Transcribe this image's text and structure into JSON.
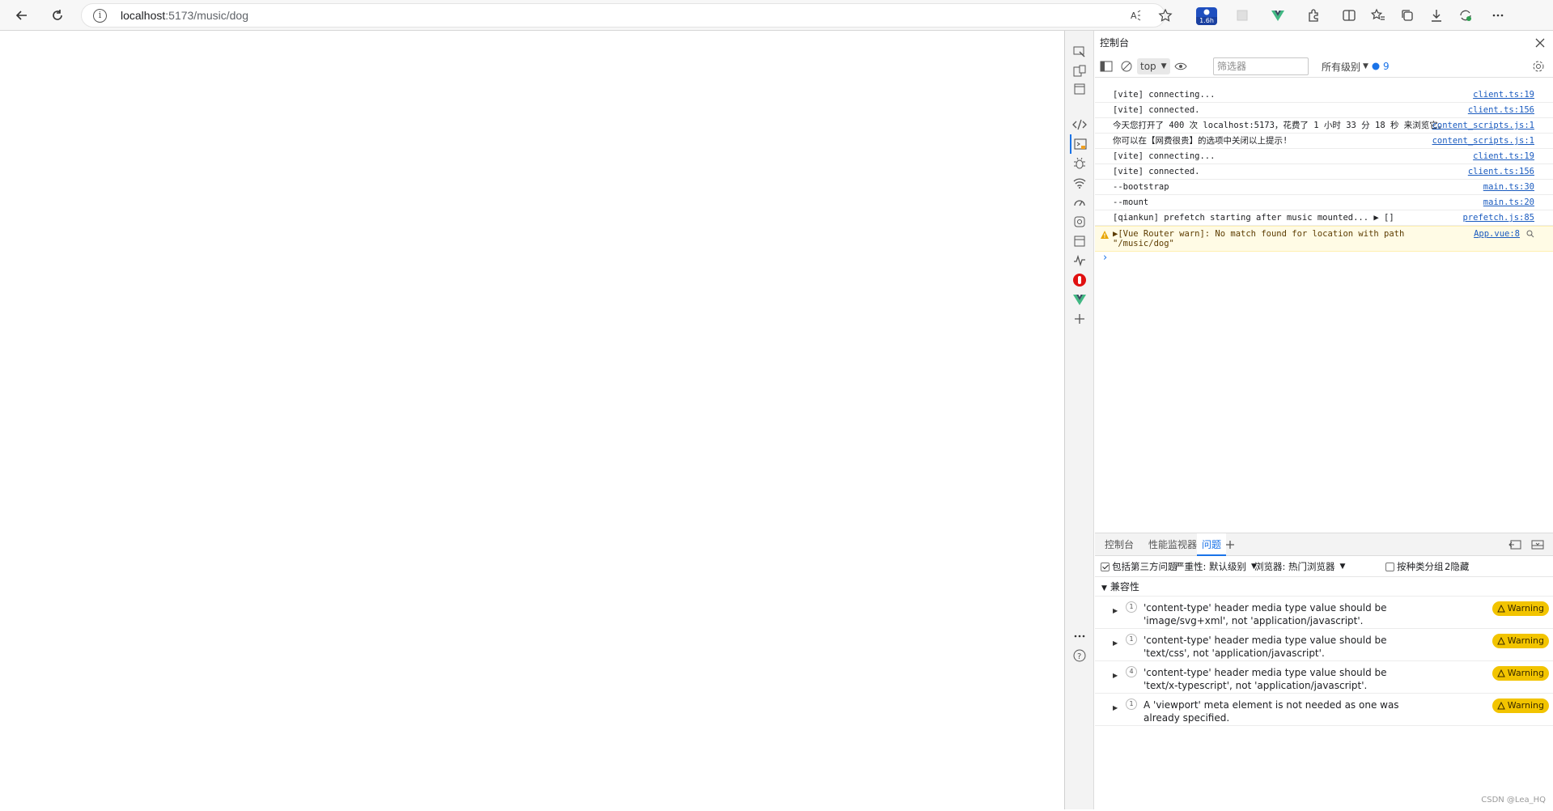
{
  "browser": {
    "url_host": "localhost",
    "url_path": ":5173/music/dog",
    "ext_badge": "1.6h"
  },
  "devtools": {
    "panel_title": "控制台",
    "console_toolbar": {
      "context": "top",
      "filter_placeholder": "筛选器",
      "levels": "所有级别",
      "message_count": "9"
    },
    "logs": [
      {
        "text": "[vite] connecting...",
        "src": "client.ts:19"
      },
      {
        "text": "[vite] connected.",
        "src": "client.ts:156"
      },
      {
        "text": "今天您打开了 400 次 localhost:5173，花费了 1 小时 33 分 18 秒 来浏览它。",
        "src": "content_scripts.js:1"
      },
      {
        "text": "你可以在【网费很贵】的选项中关闭以上提示!",
        "src": "content_scripts.js:1"
      },
      {
        "text": "[vite] connecting...",
        "src": "client.ts:19"
      },
      {
        "text": "[vite] connected.",
        "src": "client.ts:156"
      },
      {
        "text": "--bootstrap",
        "src": "main.ts:30"
      },
      {
        "text": "--mount",
        "src": "main.ts:20"
      },
      {
        "text": "[qiankun] prefetch starting after music mounted... ▶ []",
        "src": "prefetch.js:85"
      }
    ],
    "warning": {
      "text": "▶[Vue Router warn]: No match found for location with path \"/music/dog\"",
      "src": "App.vue:8"
    },
    "drawer": {
      "tabs": [
        "控制台",
        "性能监视器",
        "问题"
      ],
      "active_tab": "问题",
      "include_third_party": "包括第三方问题",
      "severity": "严重性: 默认级别",
      "browser_filter": "浏览器:  热门浏览器",
      "group_by_kind": "按种类分组",
      "hidden": "2隐藏",
      "category": "兼容性",
      "issues": [
        {
          "count": "1",
          "text": "'content-type' header media type value should be 'image/svg+xml', not 'application/javascript'.",
          "badge": "Warning"
        },
        {
          "count": "1",
          "text": "'content-type' header media type value should be 'text/css', not 'application/javascript'.",
          "badge": "Warning"
        },
        {
          "count": "4",
          "text": "'content-type' header media type value should be 'text/x-typescript', not 'application/javascript'.",
          "badge": "Warning"
        },
        {
          "count": "1",
          "text": "A 'viewport' meta element is not needed as one was already specified.",
          "badge": "Warning"
        }
      ]
    },
    "watermark": "CSDN @Lea_HQ"
  }
}
